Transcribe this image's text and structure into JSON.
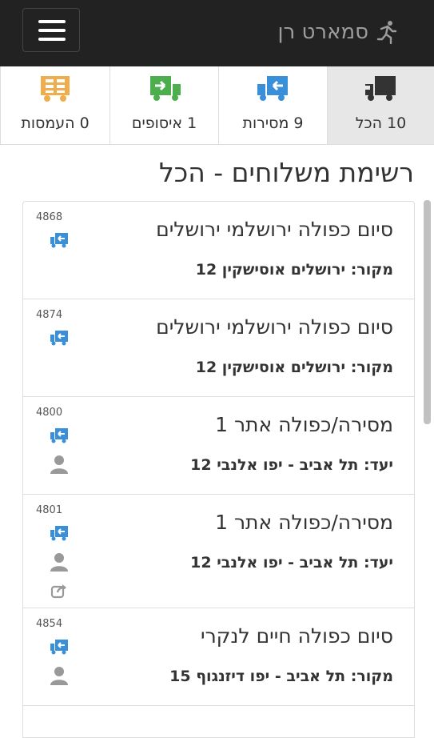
{
  "header": {
    "brand_name": "סמארט רן",
    "brand_icon": "runner-icon",
    "menu_icon": "hamburger-icon"
  },
  "tabs": [
    {
      "count": "10",
      "label": "10 הכל",
      "icon": "truck-icon",
      "color": "#333333",
      "active": true
    },
    {
      "count": "9",
      "label": "9 מסירות",
      "icon": "delivery-truck-icon",
      "color": "#3a8fd9",
      "active": false
    },
    {
      "count": "1",
      "label": "1 איסופים",
      "icon": "pickup-truck-icon",
      "color": "#4cae4c",
      "active": false
    },
    {
      "count": "0",
      "label": "0 העמסות",
      "icon": "loading-icon",
      "color": "#f0ad4e",
      "active": false
    }
  ],
  "page_title": "רשימת משלוחים - הכל",
  "shipments": [
    {
      "id": "4868",
      "title": "סיום כפולה ירושלמי ירושלים",
      "subtitle": "מקור: ירושלים אוסישקין 12",
      "has_person": false,
      "has_share": false
    },
    {
      "id": "4874",
      "title": "סיום כפולה ירושלמי ירושלים",
      "subtitle": "מקור: ירושלים אוסישקין 12",
      "has_person": false,
      "has_share": false
    },
    {
      "id": "4800",
      "title": "מסירה/כפולה אתר 1",
      "subtitle": "יעד: תל אביב - יפו אלנבי 12",
      "has_person": true,
      "has_share": false
    },
    {
      "id": "4801",
      "title": "מסירה/כפולה אתר 1",
      "subtitle": "יעד: תל אביב - יפו אלנבי 12",
      "has_person": true,
      "has_share": true
    },
    {
      "id": "4854",
      "title": "סיום כפולה חיים לנקרי",
      "subtitle": "מקור: תל אביב - יפו דיזנגוף 15",
      "has_person": true,
      "has_share": false
    }
  ],
  "colors": {
    "header_bg": "#222222",
    "delivery_blue": "#3a8fd9",
    "pickup_green": "#4cae4c",
    "loading_orange": "#f0ad4e",
    "person_gray": "#999999"
  }
}
